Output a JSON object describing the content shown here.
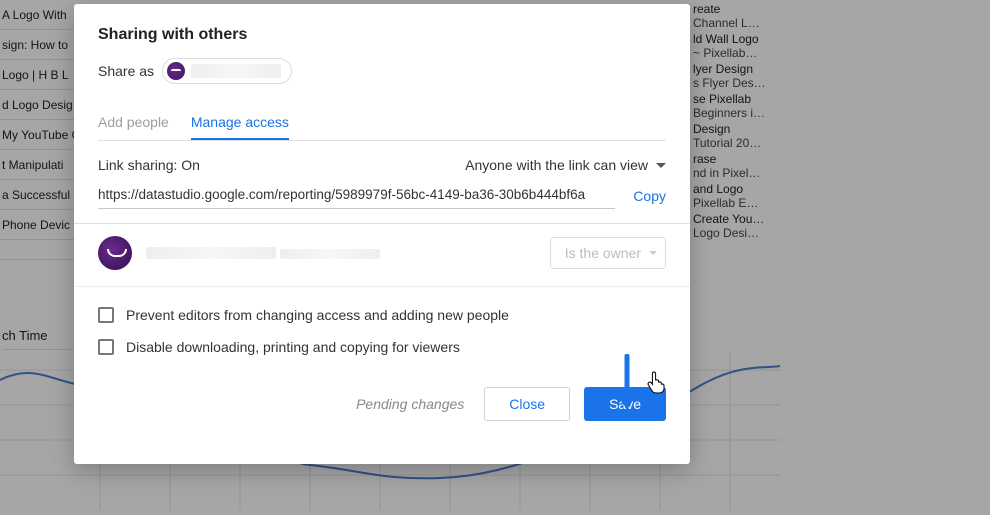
{
  "bg_left_rows": [
    "A Logo With",
    "sign: How to",
    "Logo | H B L",
    "d Logo Desig",
    "My YouTube C",
    "t Manipulati",
    "a Successful",
    "Phone Devic"
  ],
  "bg_left_label": "ch Time",
  "bg_right_items": [
    {
      "l1": "reate",
      "l2": "Channel L…"
    },
    {
      "l1": "ld Wall Logo",
      "l2": "~ Pixellab…"
    },
    {
      "l1": "lyer Design",
      "l2": "s Flyer Des…"
    },
    {
      "l1": "se Pixellab",
      "l2": "Beginners i…"
    },
    {
      "l1": "Design",
      "l2": "Tutorial 20…"
    },
    {
      "l1": "rase",
      "l2": "nd in Pixel…"
    },
    {
      "l1": "and Logo",
      "l2": "Pixellab E…"
    },
    {
      "l1": "Create You…",
      "l2": "Logo Desi…"
    }
  ],
  "modal": {
    "title": "Sharing with others",
    "share_as_label": "Share as",
    "tabs": {
      "add": "Add people",
      "manage": "Manage access"
    },
    "link_sharing_label": "Link sharing: On",
    "scope_label": "Anyone with the link can view",
    "url": "https://datastudio.google.com/reporting/5989979f-56bc-4149-ba36-30b6b444bf6a",
    "copy_label": "Copy",
    "role_label": "Is the owner",
    "opt_prevent": "Prevent editors from changing access and adding new people",
    "opt_disable": "Disable downloading, printing and copying for viewers",
    "pending": "Pending changes",
    "close": "Close",
    "save": "Save"
  }
}
